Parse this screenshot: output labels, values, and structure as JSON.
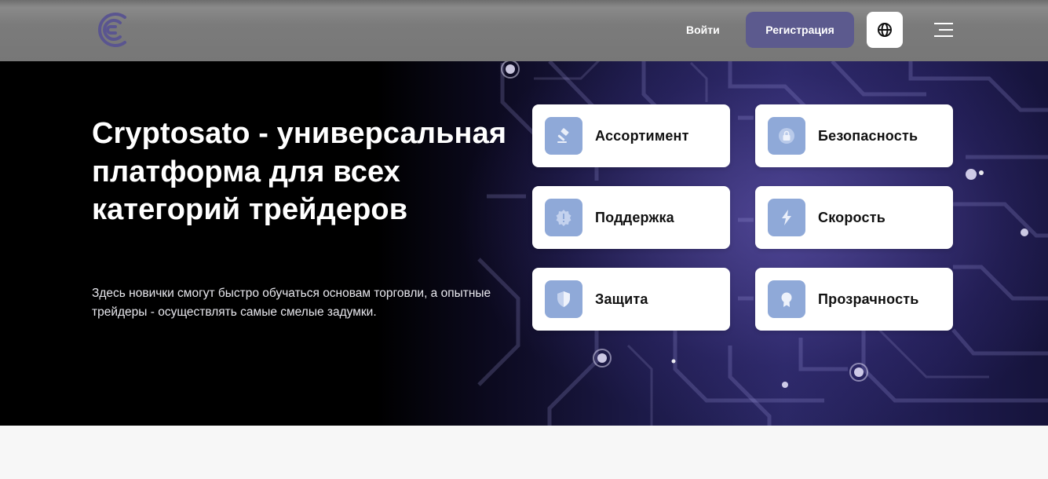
{
  "header": {
    "login_label": "Войти",
    "register_label": "Регистрация",
    "register_color": "#5c5a8e",
    "language_icon": "globe-icon",
    "menu_icon": "hamburger-menu-icon",
    "logo_icon": "cryptosato-logo"
  },
  "hero": {
    "title": "Cryptosato - универсальная платформа для всех категорий трейдеров",
    "subtitle": "Здесь новички смогут быстро обучаться основам торговли, а опытные трейдеры - осуществлять самые смелые задумки."
  },
  "features": [
    {
      "label": "Ассортимент",
      "icon": "hammer-icon"
    },
    {
      "label": "Безопасность",
      "icon": "lock-icon"
    },
    {
      "label": "Поддержка",
      "icon": "alert-badge-icon"
    },
    {
      "label": "Скорость",
      "icon": "lightning-icon"
    },
    {
      "label": "Защита",
      "icon": "shield-icon"
    },
    {
      "label": "Прозрачность",
      "icon": "award-icon"
    }
  ],
  "colors": {
    "feature_icon_bg": "#8fa9d8",
    "hero_accent": "#2a2764"
  }
}
